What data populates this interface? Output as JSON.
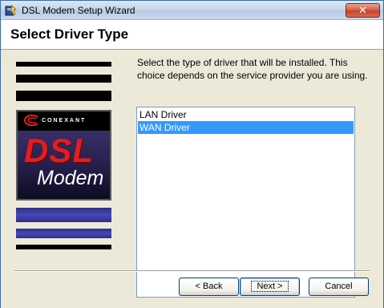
{
  "window": {
    "title": "DSL Modem Setup Wizard",
    "close_label": "✕"
  },
  "header": {
    "title": "Select Driver Type"
  },
  "logo": {
    "brand": "CONEXANT",
    "line1": "DSL",
    "line2": "Modem"
  },
  "instructions": "Select the type of driver that will be installed. This choice depends on the service provider you are using.",
  "driver_list": {
    "items": [
      "LAN Driver",
      "WAN Driver"
    ],
    "selected": "WAN Driver"
  },
  "buttons": {
    "back": "< Back",
    "next": "Next >",
    "cancel": "Cancel"
  },
  "colors": {
    "selection": "#3399ff",
    "dsl_red": "#e41d1d",
    "stripe_blue": "#4747b8"
  }
}
